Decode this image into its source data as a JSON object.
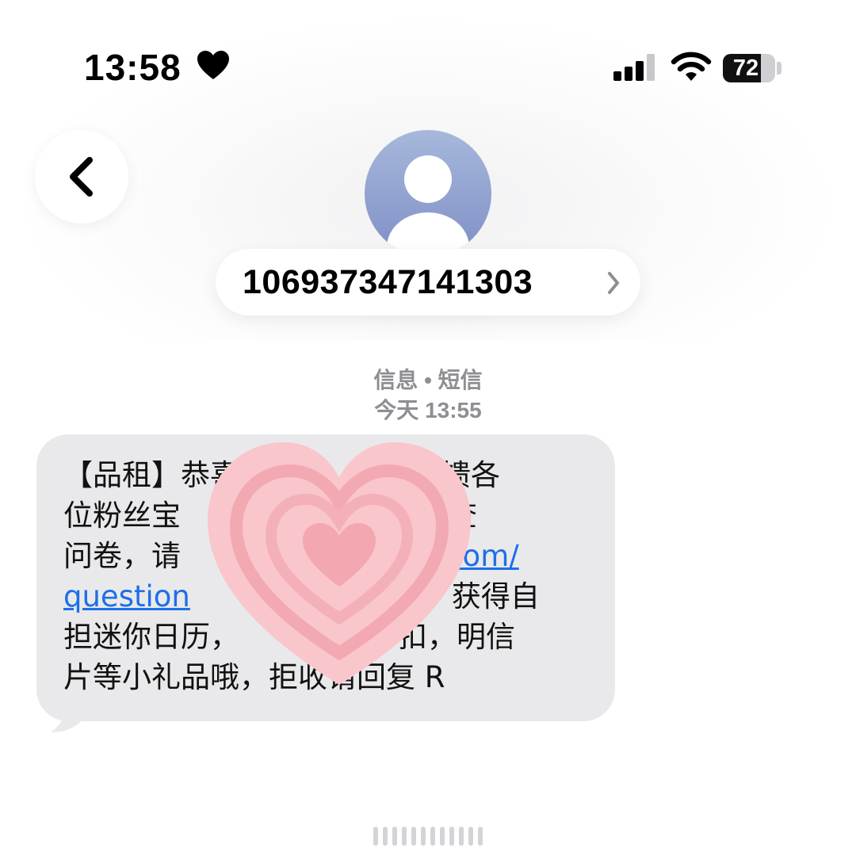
{
  "status_bar": {
    "time": "13:58",
    "battery": "72",
    "battery_level": 0.72
  },
  "header": {
    "contact_number": "106937347141303"
  },
  "conversation": {
    "service_label": "信息 • 短信",
    "timestamp": "今天 13:55",
    "message_lines": [
      "【品租】恭喜",
      "位粉丝宝",
      "问卷，请",
      "question",
      "担迷你日历，",
      "片等小礼品哦，拒收请回复 R"
    ],
    "message_fragments": {
      "line1_tail": "回馈各",
      "line2_tail": "调查",
      "line3_link": "u.com/",
      "line4_tail": "获得自",
      "line5_tail": "扣，明信"
    }
  },
  "colors": {
    "bubble": "#e9e9eb",
    "link": "#1d6fe8",
    "meta_text": "#8e8e93",
    "sticker": "#f7b8bf"
  },
  "icons": [
    "heart-icon",
    "signal-icon",
    "wifi-icon",
    "battery-icon",
    "back-chevron-icon",
    "contact-avatar-icon",
    "chevron-right-icon",
    "heart-sticker"
  ]
}
